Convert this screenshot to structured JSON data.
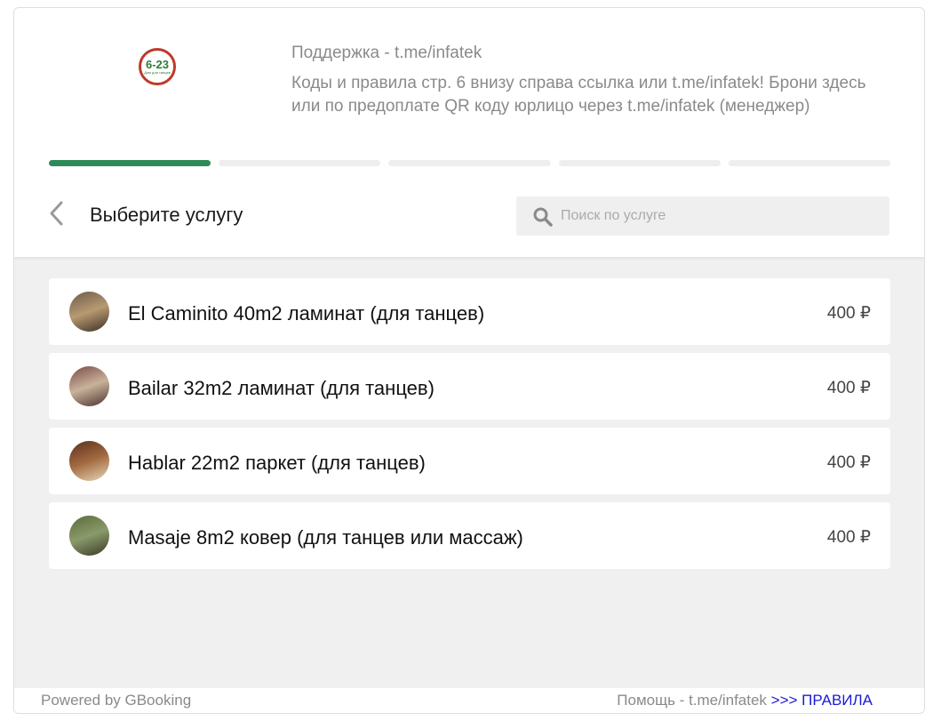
{
  "header": {
    "logo_text": "6-23",
    "logo_subtext": "Дом для танцев",
    "support_line": "Поддержка - t.me/infatek",
    "notice": "Коды и правила стр. 6 внизу справа ссылка или t.me/infatek! Брони здесь или по предоплате QR коду юрлицо через t.me/infatek (менеджер)"
  },
  "progress": {
    "total_steps": 5,
    "current_step": 1
  },
  "titlebar": {
    "title": "Выберите услугу",
    "search_placeholder": "Поиск по услуге"
  },
  "services": [
    {
      "name": "El Caminito 40m2 ламинат (для танцев)",
      "price": "400 ₽",
      "thumb_colors": [
        "#6d5a4a",
        "#b89a72",
        "#3a2e26"
      ]
    },
    {
      "name": "Bailar 32m2 ламинат (для танцев)",
      "price": "400 ₽",
      "thumb_colors": [
        "#7a4a4a",
        "#c9b29a",
        "#4a3030"
      ]
    },
    {
      "name": "Hablar 22m2 паркет (для танцев)",
      "price": "400 ₽",
      "thumb_colors": [
        "#5a3020",
        "#a36a40",
        "#e8d8b8"
      ]
    },
    {
      "name": "Masaje 8m2 ковер (для танцев или массаж)",
      "price": "400 ₽",
      "thumb_colors": [
        "#5a6a3a",
        "#8a9a6a",
        "#3a3a2a"
      ]
    }
  ],
  "footer": {
    "powered_by": "Powered by GBooking",
    "help_text": "Помощь - t.me/infatek ",
    "rules_link": ">>> ПРАВИЛА"
  }
}
